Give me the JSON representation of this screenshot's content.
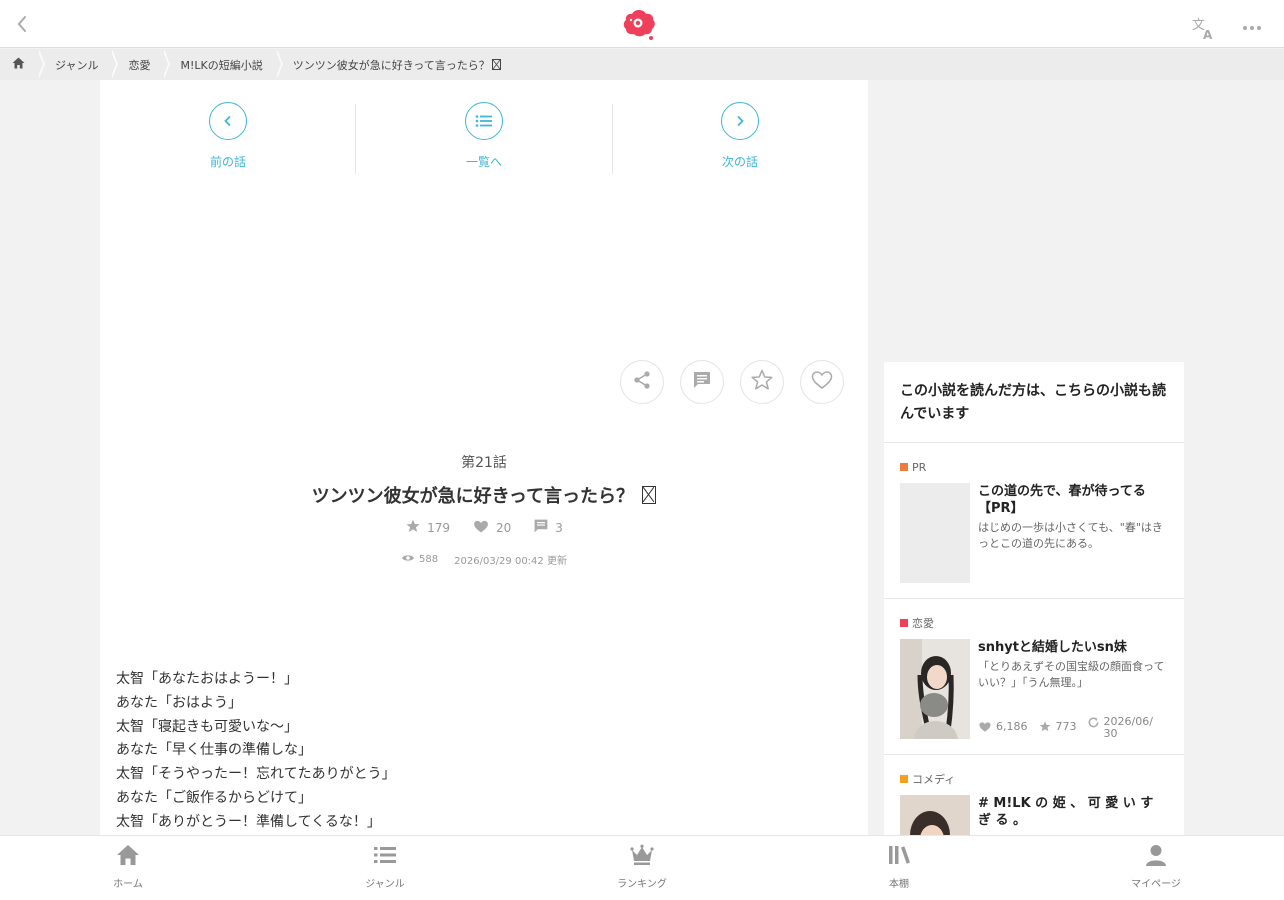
{
  "colors": {
    "accent": "#3fb7d6",
    "brand": "#f03f5a",
    "pr": "#f07a3c",
    "romance": "#f03f5a",
    "comedy": "#f4a020"
  },
  "header": {
    "back_icon": "chevron-left-icon",
    "logo_icon": "brand-logo-icon",
    "translate_icon": "translate-icon",
    "more_icon": "more-icon"
  },
  "breadcrumb": [
    {
      "label": "",
      "icon": "home-icon"
    },
    {
      "label": "ジャンル"
    },
    {
      "label": "恋愛"
    },
    {
      "label": "M!LKの短編小説"
    },
    {
      "label": "ツンツン彼女が急に好きって言ったら？"
    }
  ],
  "episode_nav": {
    "prev": "前の話",
    "list": "一覧へ",
    "next": "次の話"
  },
  "episode": {
    "number": "第21話",
    "title": "ツンツン彼女が急に好きって言ったら？",
    "stars": "179",
    "hearts": "20",
    "comments": "3",
    "views": "588",
    "updated": "2026/03/29 00:42 更新"
  },
  "body_lines": [
    "太智「あなたおはようー！」",
    "あなた「おはよう」",
    "太智「寝起きも可愛いな〜」",
    "あなた「早く仕事の準備しな」",
    "太智「そうやったー！忘れてたありがとう」",
    "あなた「ご飯作るからどけて」",
    "太智「ありがとうー！準備してくるな！」"
  ],
  "sidebar": {
    "heading": "この小説を読んだ方は、こちらの小説も読んでいます",
    "items": [
      {
        "category": "PR",
        "title": "この道の先で、春が待ってる【PR】",
        "desc": "はじめの一歩は小さくても、\"春\"はきっとこの道の先にある。"
      },
      {
        "category": "恋愛",
        "title": "snhytと結婚したいsn妹",
        "desc": "「とりあえずその国宝級の顔面食っていい？」「うん無理。」",
        "hearts": "6,186",
        "stars": "773",
        "date": "2026/06/30"
      },
      {
        "category": "コメディ",
        "title": "# M!LK の 姫 、 可 愛 い す ぎ る 。"
      }
    ]
  },
  "tabbar": {
    "home": "ホーム",
    "genre": "ジャンル",
    "ranking": "ランキング",
    "shelf": "本棚",
    "mypage": "マイページ"
  }
}
